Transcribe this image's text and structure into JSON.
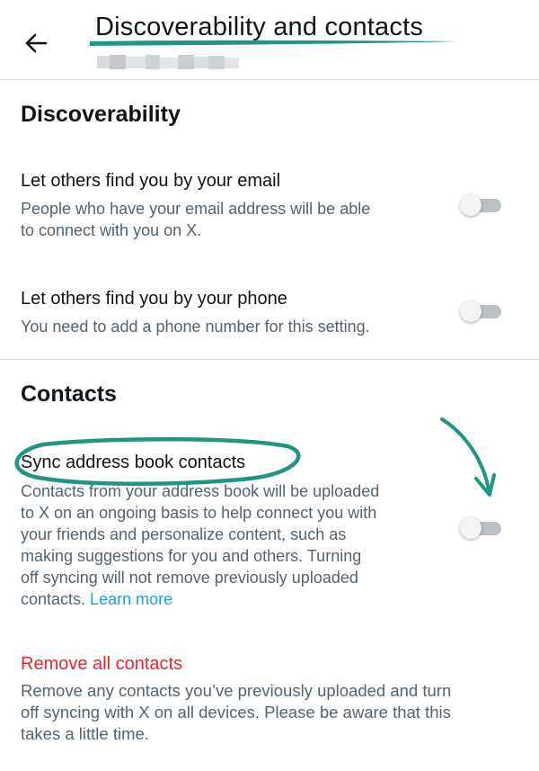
{
  "header": {
    "back_icon": "arrow-left-icon",
    "title": "Discoverability and contacts"
  },
  "discoverability": {
    "heading": "Discoverability",
    "email": {
      "title": "Let others find you by your email",
      "description_lines": [
        "People who have your email address will be able",
        "to connect with you on X."
      ],
      "toggle_on": false
    },
    "phone": {
      "title": "Let others find you by your phone",
      "description_lines": [
        "You need to add a phone number for this setting."
      ],
      "toggle_on": false
    }
  },
  "contacts": {
    "heading": "Contacts",
    "sync": {
      "title": "Sync address book contacts",
      "description_lines": [
        "Contacts from your address book will be uploaded",
        "to X on an ongoing basis to help connect you with",
        "your friends and personalize content, such as",
        "making suggestions for you and others. Turning",
        "off syncing will not remove previously uploaded"
      ],
      "description_last": "contacts. ",
      "learn_more": "Learn more",
      "toggle_on": false
    },
    "remove": {
      "link": "Remove all contacts",
      "description_lines": [
        "Remove any contacts you’ve previously uploaded and turn",
        "off syncing with X on all devices. Please be aware that this",
        "takes a little time."
      ]
    }
  },
  "colors": {
    "annotation_green": "#1f9683",
    "link_blue": "#1d9bf0",
    "danger_red": "#f4212e",
    "secondary_text": "#536471"
  }
}
